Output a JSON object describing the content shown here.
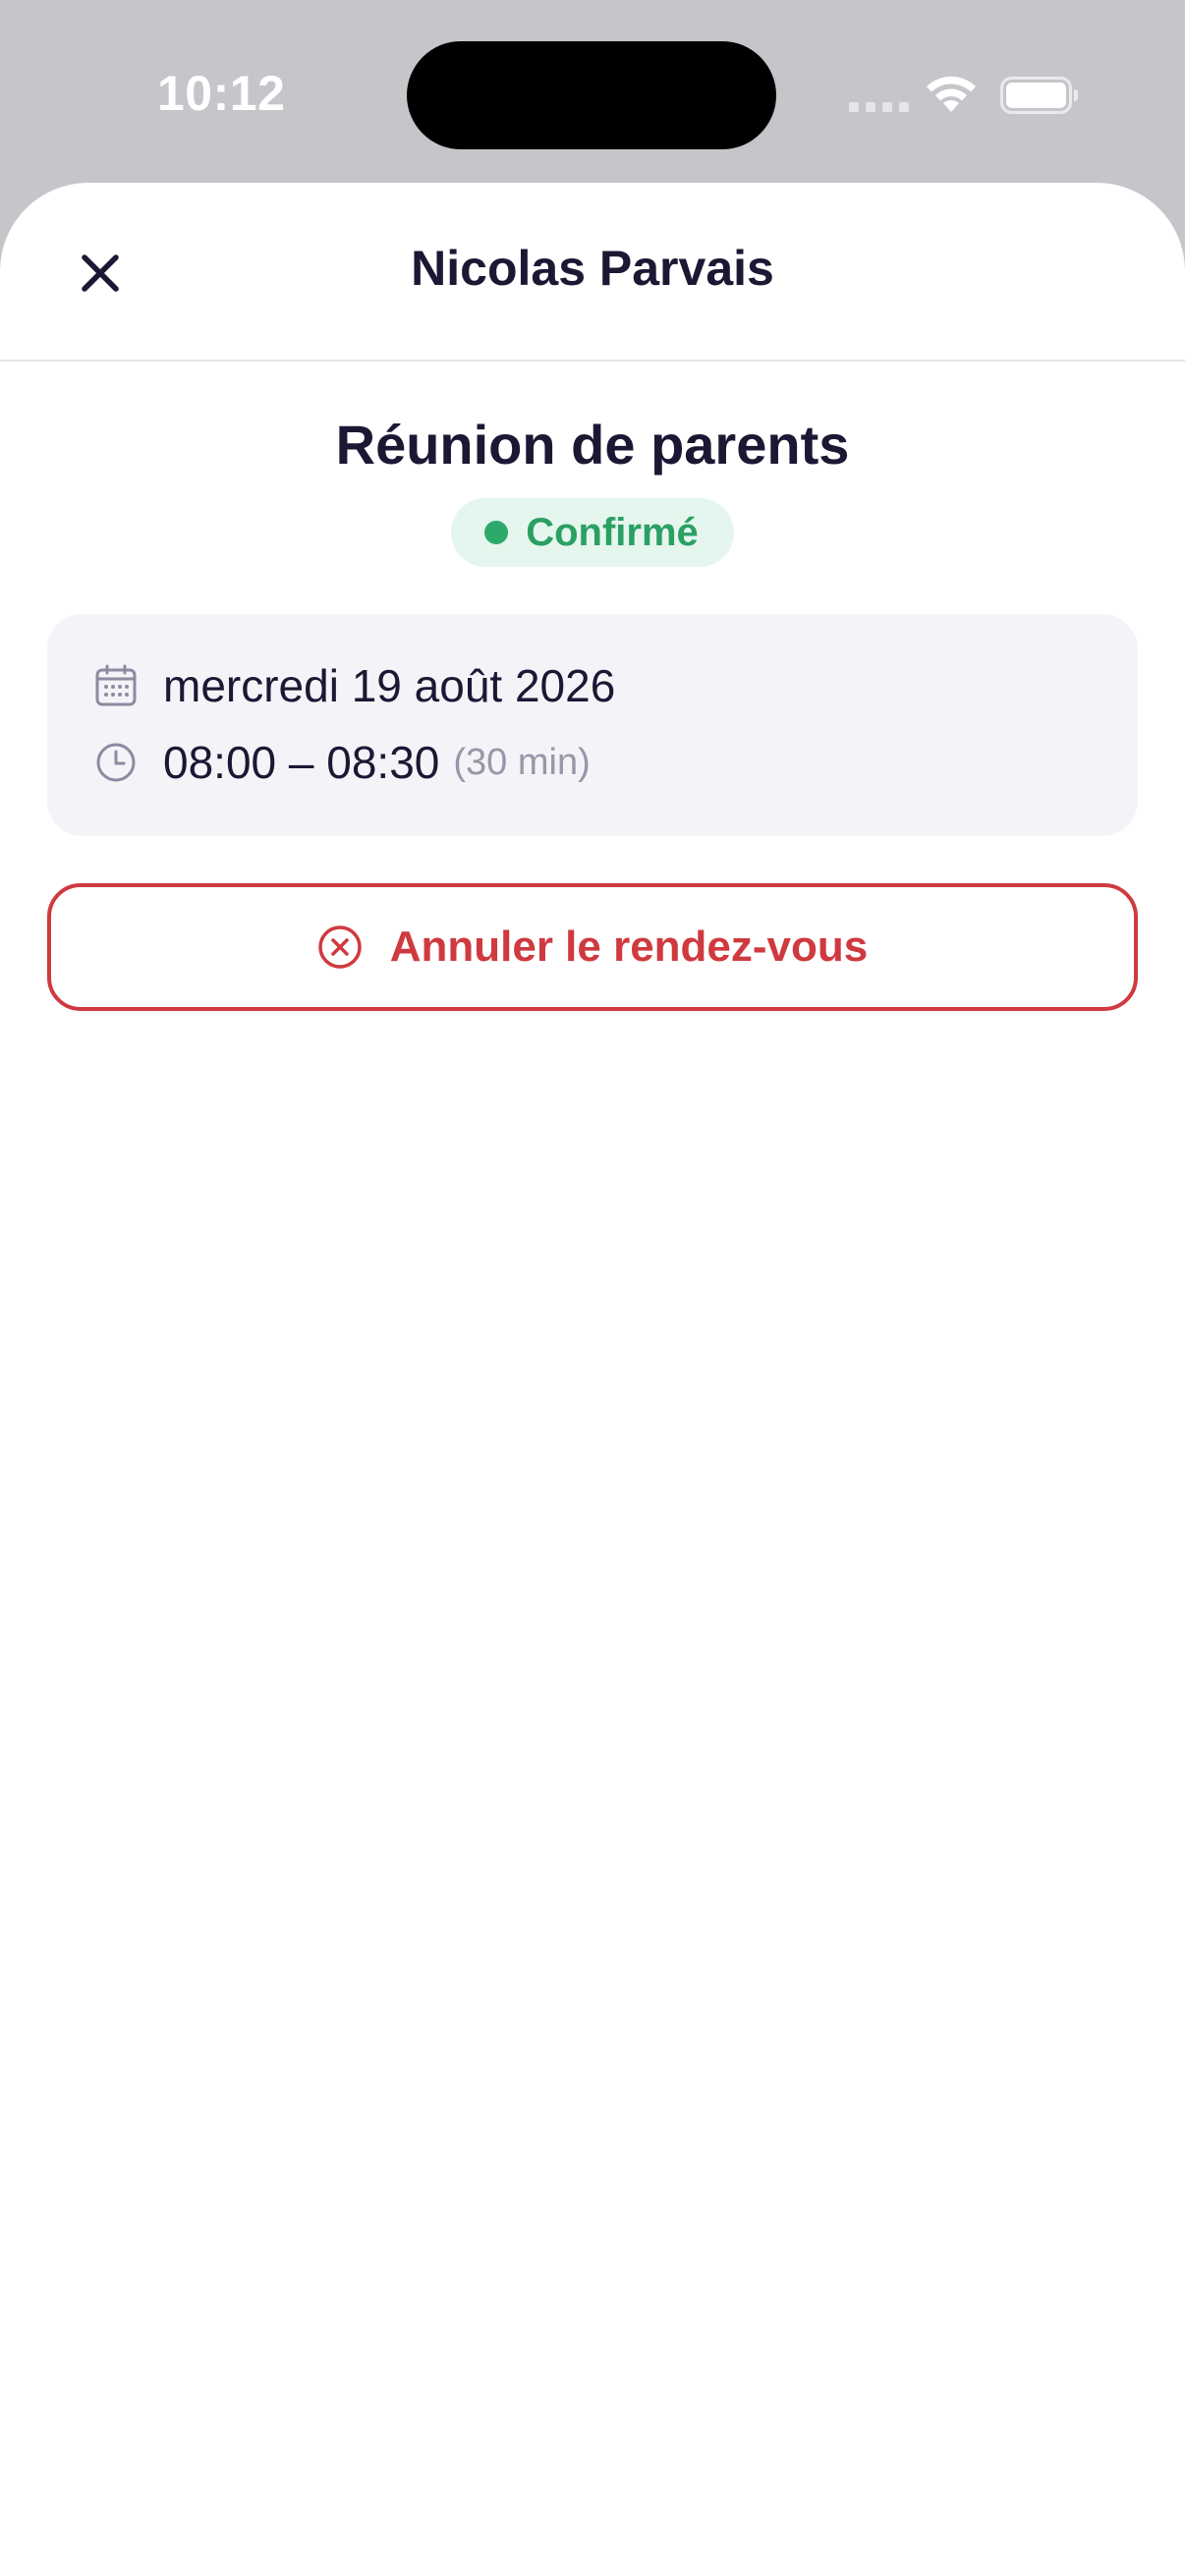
{
  "status_bar": {
    "time": "10:12"
  },
  "header": {
    "title": "Nicolas Parvais",
    "close_icon": "close-icon"
  },
  "event": {
    "title": "Réunion de parents",
    "status": {
      "label": "Confirmé",
      "color": "#2aa063",
      "background": "#e5f6ee"
    },
    "date": "mercredi 19 août 2026",
    "time_range": "08:00 – 08:30",
    "duration": "(30 min)",
    "date_icon": "calendar-icon",
    "time_icon": "clock-icon"
  },
  "actions": {
    "cancel_label": "Annuler le rendez-vous",
    "cancel_icon": "cancel-circle-icon",
    "cancel_color": "#cf3a3f"
  },
  "colors": {
    "text_primary": "#1c1733",
    "text_muted": "#9a95a8",
    "card_background": "#f4f3f8"
  }
}
